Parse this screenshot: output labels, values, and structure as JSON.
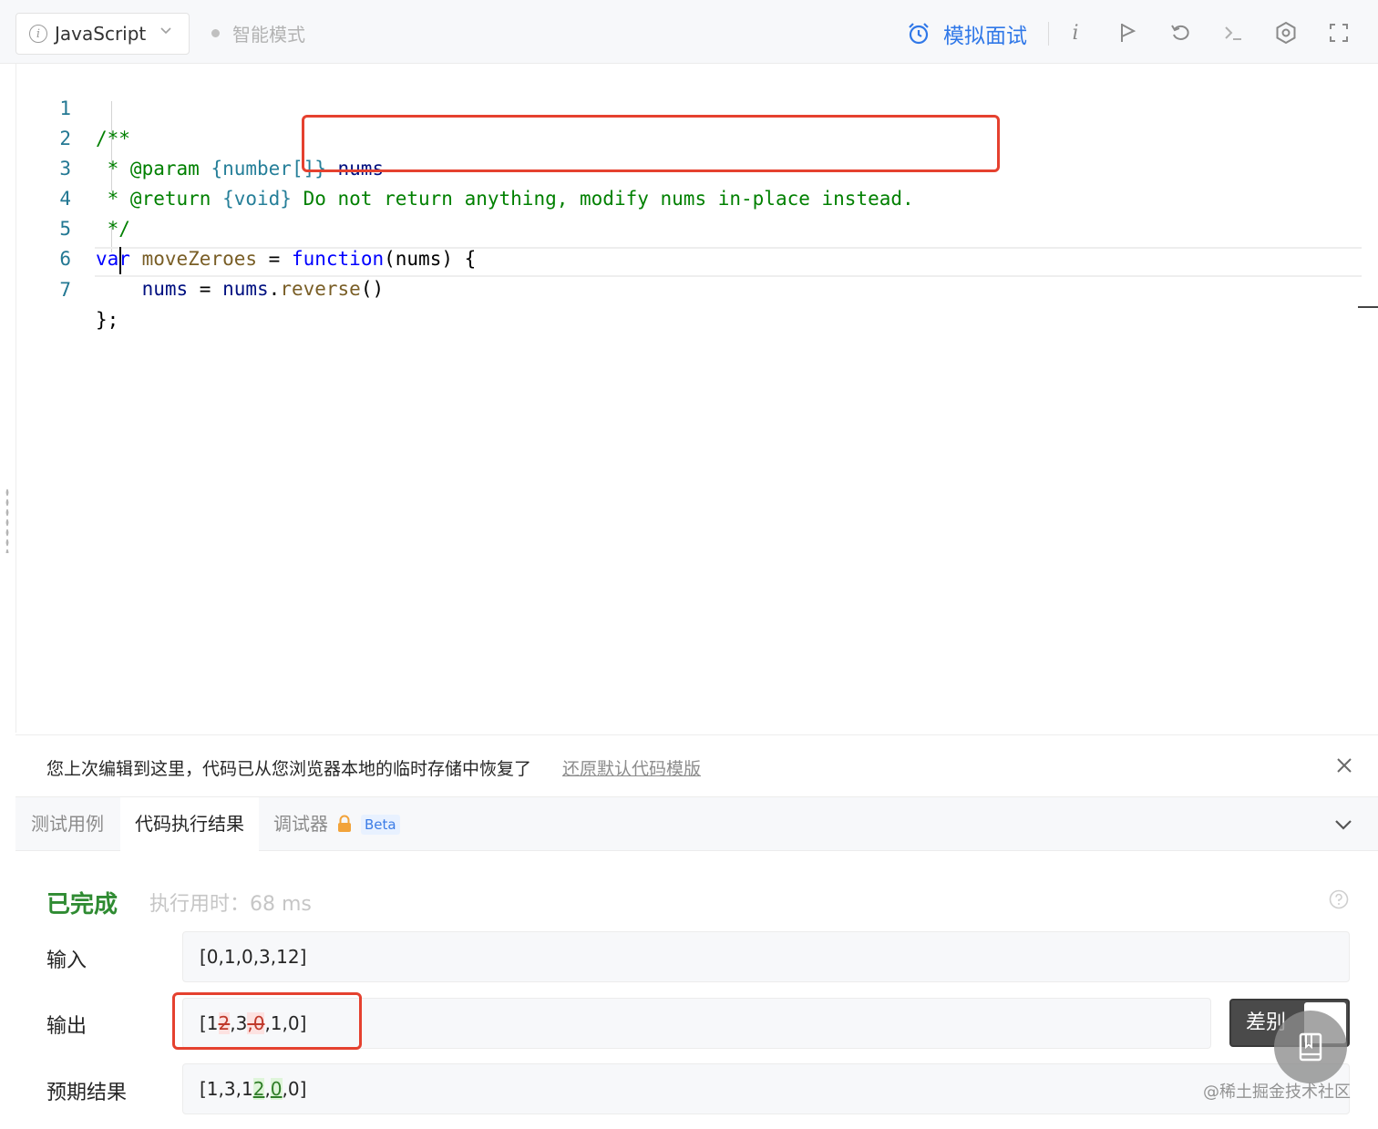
{
  "toolbar": {
    "language": "JavaScript",
    "smart_mode": "智能模式",
    "mock_interview": "模拟面试"
  },
  "editor": {
    "line_numbers": [
      "1",
      "2",
      "3",
      "4",
      "5",
      "6",
      "7"
    ],
    "line1": "/**",
    "line2_a": " * @param ",
    "line2_b": "{number[]}",
    "line2_c": " nums",
    "line3_a": " * @return ",
    "line3_b": "{void}",
    "line3_c": " Do not return anything, modify nums in-place instead.",
    "line4": " */",
    "line5_kw": "var",
    "line5_name": "moveZeroes",
    "line5_eq": " = ",
    "line5_fn": "function",
    "line5_params": "(nums) {",
    "line6_a": "    nums",
    "line6_b": " = ",
    "line6_c": "nums",
    "line6_d": ".",
    "line6_e": "reverse",
    "line6_f": "()",
    "line7": "};"
  },
  "notice": {
    "text": "您上次编辑到这里，代码已从您浏览器本地的临时存储中恢复了",
    "link": "还原默认代码模版"
  },
  "tabs": {
    "testcase": "测试用例",
    "result": "代码执行结果",
    "debugger": "调试器",
    "beta": "Beta"
  },
  "result": {
    "status": "已完成",
    "exec_time": "执行用时：68 ms",
    "input_label": "输入",
    "input_value": "[0,1,0,3,12]",
    "output_label": "输出",
    "output_parts": [
      "[1",
      "2",
      ",3",
      ",0",
      ",1,0]"
    ],
    "expected_label": "预期结果",
    "expected_parts": [
      "[1,3,1",
      "2",
      ",",
      "0",
      ",0]"
    ],
    "diff_button": "差别"
  },
  "watermark": "@稀土掘金技术社区",
  "colors": {
    "accent": "#3078e8",
    "success": "#2f8b32",
    "annotation_red": "#e5412f"
  }
}
